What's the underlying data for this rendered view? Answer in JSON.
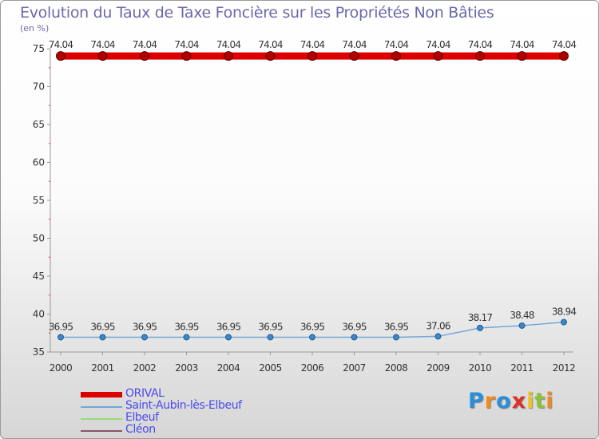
{
  "chart_data": {
    "type": "line",
    "title": "Evolution du Taux de Taxe Foncière sur les Propriétés Non Bâties",
    "ylabel": "(en %)",
    "xlabel": "",
    "x": [
      "2000",
      "2001",
      "2002",
      "2003",
      "2004",
      "2005",
      "2006",
      "2007",
      "2008",
      "2009",
      "2010",
      "2011",
      "2012"
    ],
    "ylim": [
      35,
      75
    ],
    "yticks": [
      "35",
      "40",
      "45",
      "50",
      "55",
      "60",
      "65",
      "70",
      "75"
    ],
    "grid": false,
    "legend_position": "bottom-left",
    "series": [
      {
        "name": "ORIVAL",
        "color": "#dd0000",
        "values": [
          74.04,
          74.04,
          74.04,
          74.04,
          74.04,
          74.04,
          74.04,
          74.04,
          74.04,
          74.04,
          74.04,
          74.04,
          74.04
        ],
        "labels": [
          "74.04",
          "74.04",
          "74.04",
          "74.04",
          "74.04",
          "74.04",
          "74.04",
          "74.04",
          "74.04",
          "74.04",
          "74.04",
          "74.04",
          "74.04"
        ]
      },
      {
        "name": "Saint-Aubin-lès-Elbeuf",
        "color": "#6fa8d8",
        "values": [
          36.95,
          36.95,
          36.95,
          36.95,
          36.95,
          36.95,
          36.95,
          36.95,
          36.95,
          37.06,
          38.17,
          38.48,
          38.94
        ],
        "labels": [
          "36.95",
          "36.95",
          "36.95",
          "36.95",
          "36.95",
          "36.95",
          "36.95",
          "36.95",
          "36.95",
          "37.06",
          "38.17",
          "38.48",
          "38.94"
        ]
      },
      {
        "name": "Elbeuf",
        "color": "#99dd77",
        "values": [],
        "labels": []
      },
      {
        "name": "Cléon",
        "color": "#885566",
        "values": [],
        "labels": []
      }
    ]
  },
  "brand": {
    "letters": [
      "P",
      "r",
      "o",
      "x",
      "i",
      "t",
      "i"
    ],
    "colors": [
      "#2a8fd6",
      "#f08a1c",
      "#2a8fd6",
      "#e0302a",
      "#f0c020",
      "#8ac23a",
      "#f08a1c"
    ]
  }
}
